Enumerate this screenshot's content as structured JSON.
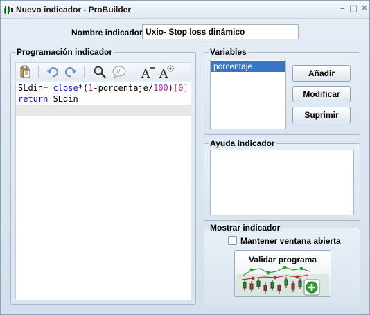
{
  "window": {
    "title": "Nuevo indicador - ProBuilder",
    "controls": [
      "minimize-icon",
      "maximize-icon",
      "close-icon"
    ]
  },
  "name": {
    "label": "Nombre indicador",
    "value": "Uxio- Stop loss dinámico"
  },
  "programming": {
    "legend": "Programación indicador",
    "toolbar": [
      "paste-icon",
      "undo-icon",
      "redo-icon",
      "search-icon",
      "comment-icon",
      "decrease-font-icon",
      "increase-font-icon"
    ],
    "code": {
      "line1": {
        "ident": "SLdin= ",
        "fn": "close",
        "op1": "*(",
        "num1": "1",
        "op2": "-porcentaje/",
        "num2": "100",
        "op3": ")",
        "idx": "[0]"
      },
      "line2": {
        "kw": "return",
        "rest": " SLdin"
      }
    }
  },
  "variables": {
    "legend": "Variables",
    "items": [
      "porcentaje"
    ],
    "add_label": "Añadir",
    "modify_label": "Modificar",
    "delete_label": "Suprimir"
  },
  "help": {
    "legend": "Ayuda indicador"
  },
  "show": {
    "legend": "Mostrar indicador",
    "keep_open_label": "Mantener ventana abierta",
    "keep_open_checked": false,
    "validate_label": "Validar programa"
  },
  "colors": {
    "selection": "#3a74c4",
    "keyword": "#1010c0",
    "number": "#9b2d9b"
  }
}
